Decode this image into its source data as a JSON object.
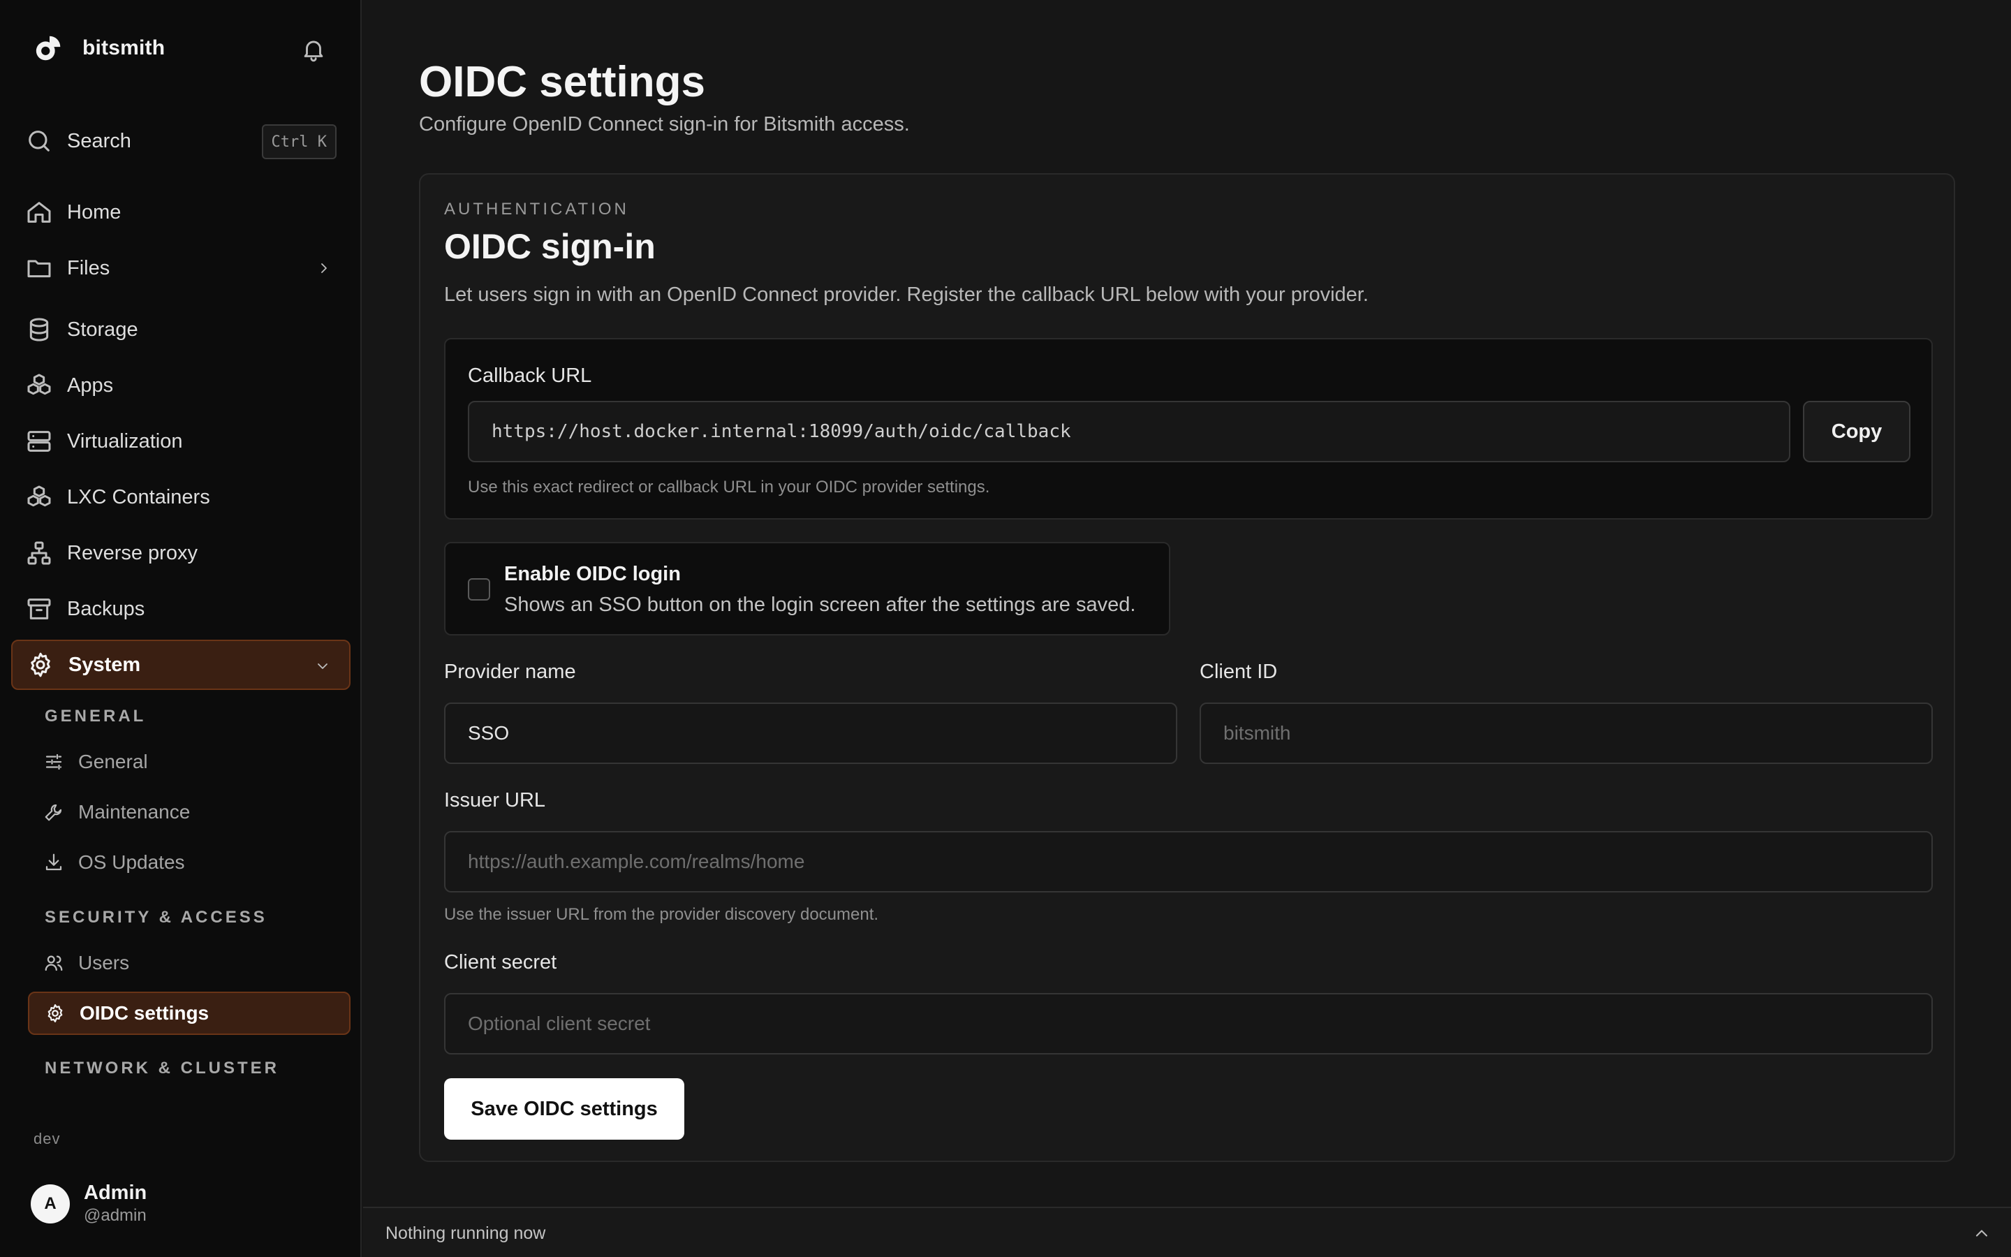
{
  "brand": {
    "name": "bitsmith"
  },
  "search": {
    "label": "Search",
    "shortcut": "Ctrl K"
  },
  "nav": {
    "home": "Home",
    "files": "Files",
    "storage": "Storage",
    "apps": "Apps",
    "virtualization": "Virtualization",
    "lxc": "LXC Containers",
    "reverse_proxy": "Reverse proxy",
    "backups": "Backups",
    "system": "System"
  },
  "system_sections": {
    "general_heading": "GENERAL",
    "general": "General",
    "maintenance": "Maintenance",
    "os_updates": "OS Updates",
    "security_heading": "SECURITY & ACCESS",
    "users": "Users",
    "oidc": "OIDC settings",
    "network_heading": "NETWORK & CLUSTER"
  },
  "env": "dev",
  "user": {
    "initial": "A",
    "name": "Admin",
    "handle": "@admin"
  },
  "page": {
    "title": "OIDC settings",
    "subtitle": "Configure OpenID Connect sign-in for Bitsmith access."
  },
  "card": {
    "eyebrow": "AUTHENTICATION",
    "title": "OIDC sign-in",
    "description": "Let users sign in with an OpenID Connect provider. Register the callback URL below with your provider."
  },
  "callback": {
    "label": "Callback URL",
    "value": "https://host.docker.internal:18099/auth/oidc/callback",
    "copy_label": "Copy",
    "hint": "Use this exact redirect or callback URL in your OIDC provider settings."
  },
  "enable": {
    "title": "Enable OIDC login",
    "description": "Shows an SSO button on the login screen after the settings are saved.",
    "checked": false
  },
  "provider": {
    "label": "Provider name",
    "value": "SSO"
  },
  "client_id": {
    "label": "Client ID",
    "placeholder": "bitsmith"
  },
  "issuer": {
    "label": "Issuer URL",
    "placeholder": "https://auth.example.com/realms/home",
    "hint": "Use the issuer URL from the provider discovery document."
  },
  "secret": {
    "label": "Client secret",
    "placeholder": "Optional client secret"
  },
  "save_label": "Save OIDC settings",
  "status": {
    "text": "Nothing running now"
  },
  "colors": {
    "accent_bg": "#3a1f12",
    "accent_border": "#6a3417",
    "background": "#161616",
    "sidebar": "#0c0c0c"
  }
}
